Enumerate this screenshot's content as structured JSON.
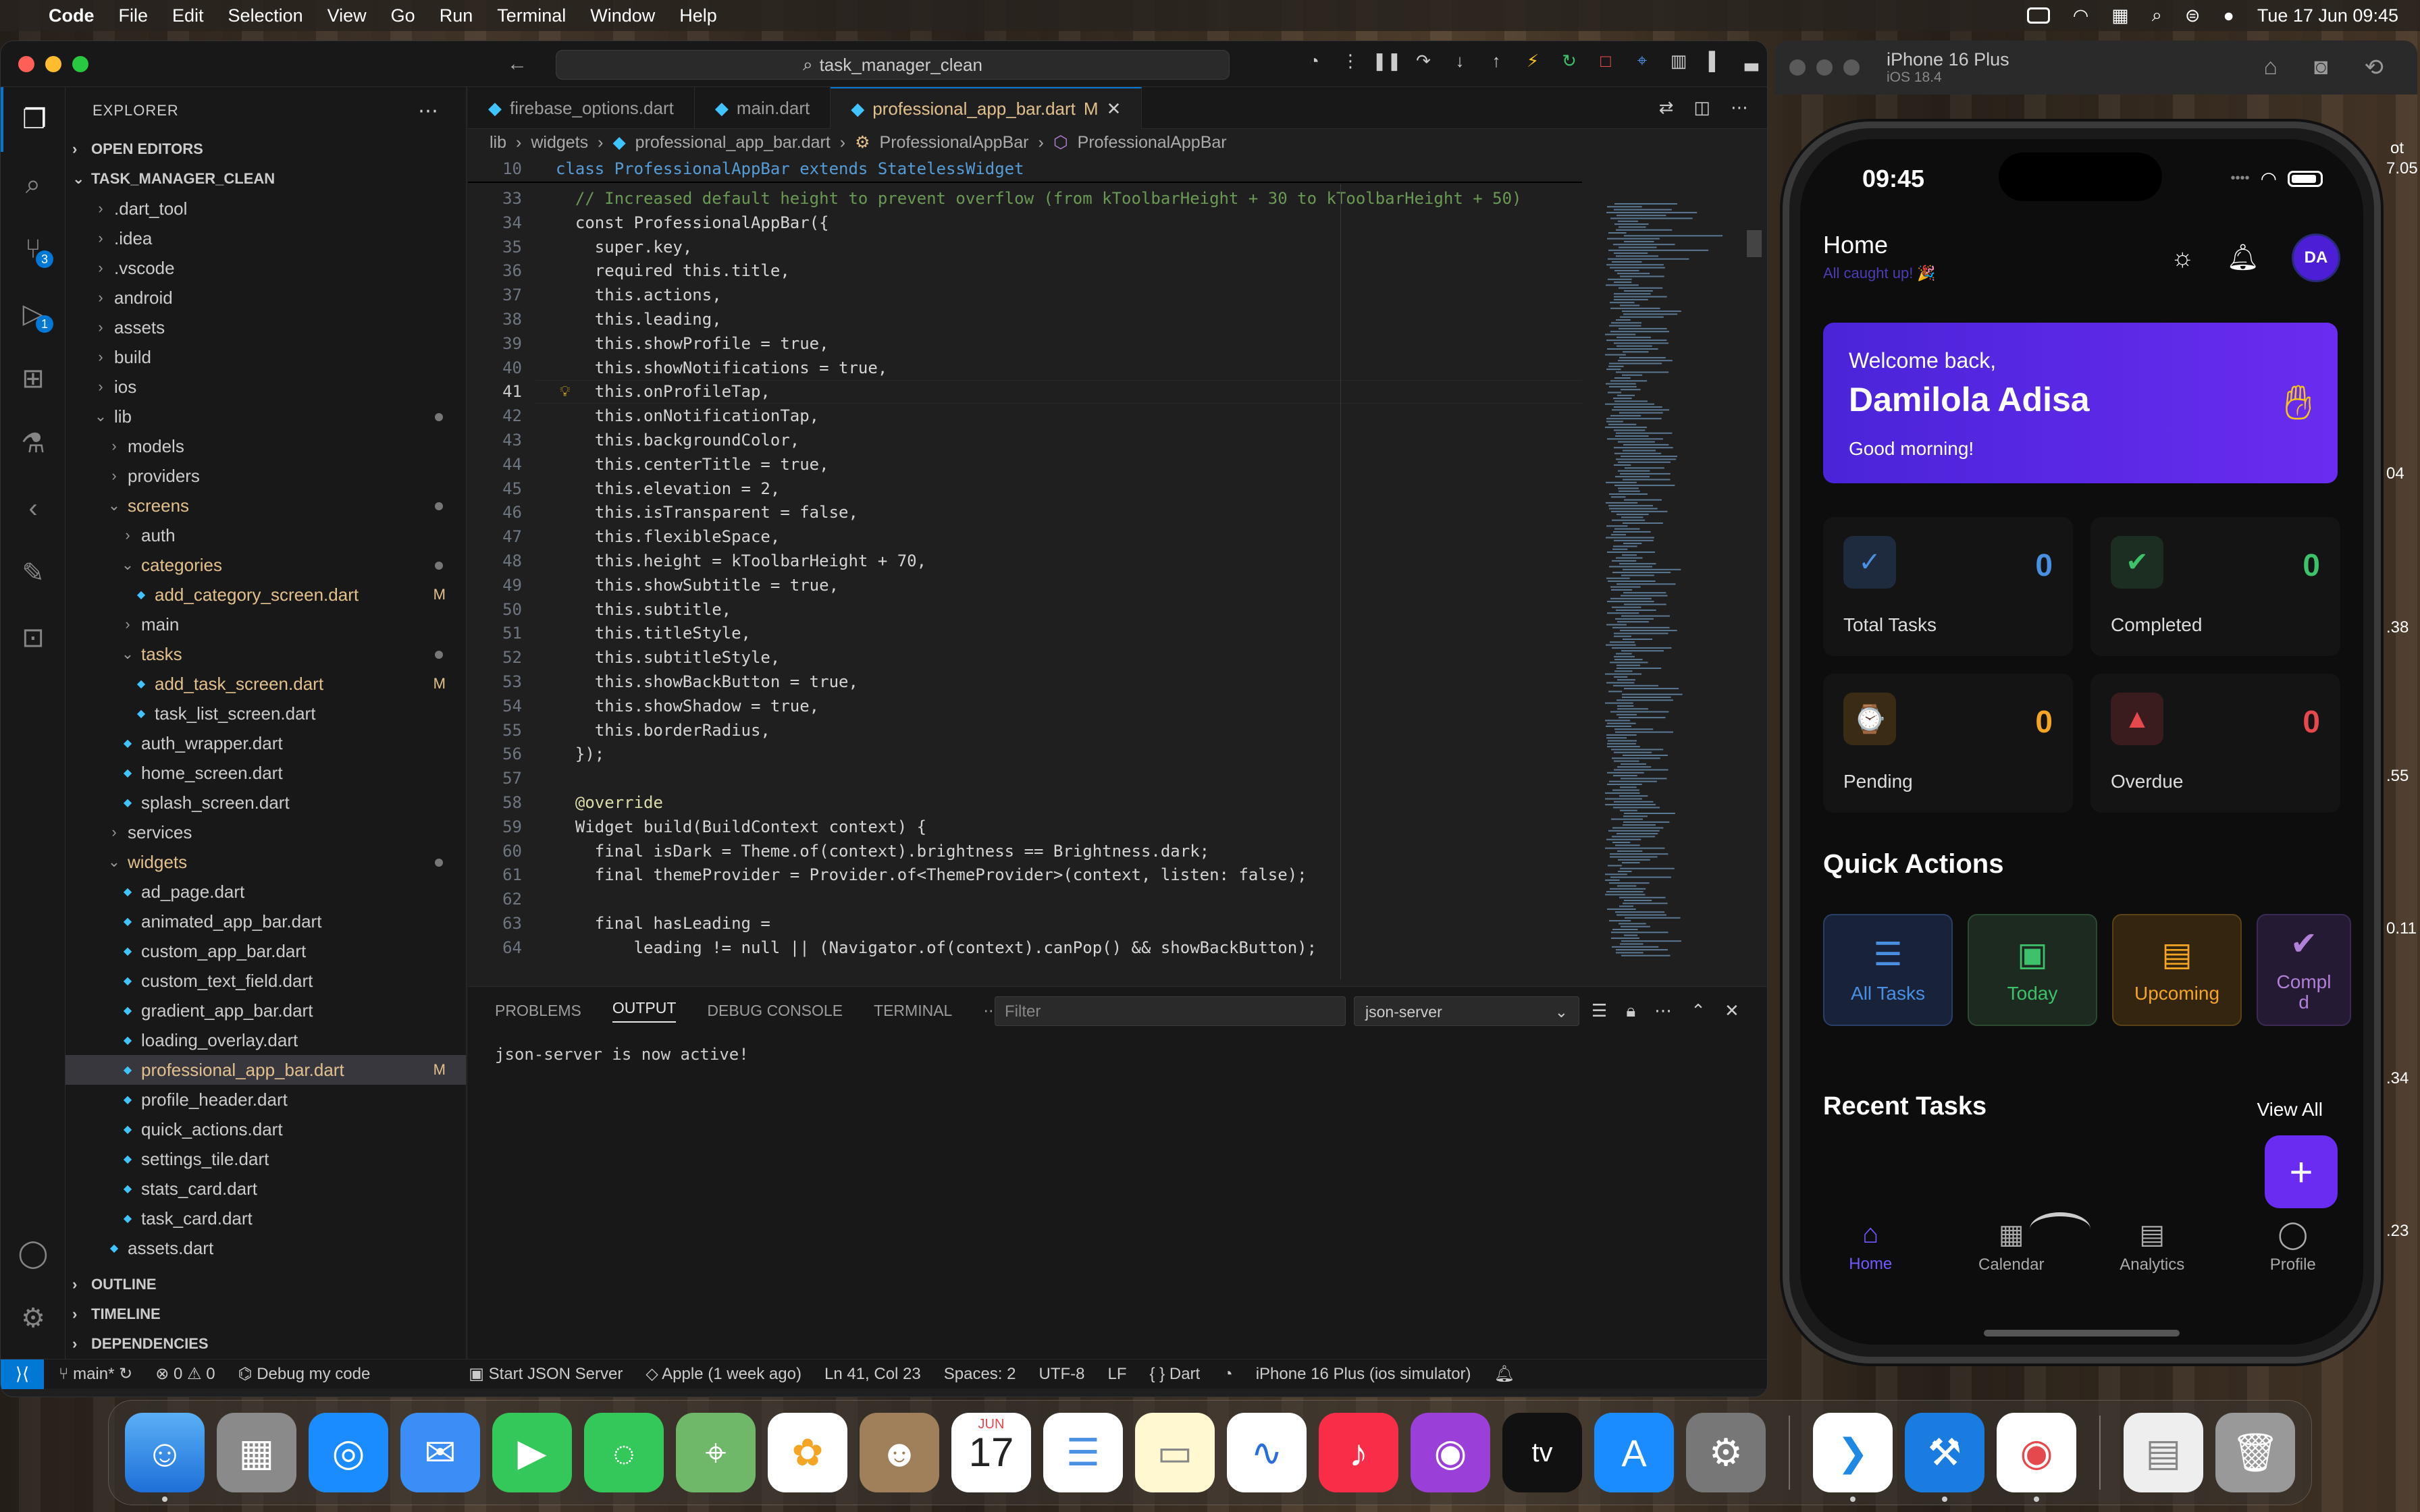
{
  "menubar": {
    "app": "Code",
    "items": [
      "File",
      "Edit",
      "Selection",
      "View",
      "Go",
      "Run",
      "Terminal",
      "Window",
      "Help"
    ],
    "clock": "Tue 17 Jun  09:45"
  },
  "vscode": {
    "search": "task_manager_clean",
    "explorer_title": "EXPLORER",
    "sections": {
      "open_editors": "OPEN EDITORS",
      "project": "TASK_MANAGER_CLEAN",
      "outline": "OUTLINE",
      "timeline": "TIMELINE",
      "dependencies": "DEPENDENCIES"
    },
    "tree": [
      {
        "label": ".dart_tool",
        "indent": 1,
        "type": "folder-closed"
      },
      {
        "label": ".idea",
        "indent": 1,
        "type": "folder-closed"
      },
      {
        "label": ".vscode",
        "indent": 1,
        "type": "folder-closed"
      },
      {
        "label": "android",
        "indent": 1,
        "type": "folder-closed"
      },
      {
        "label": "assets",
        "indent": 1,
        "type": "folder-closed"
      },
      {
        "label": "build",
        "indent": 1,
        "type": "folder-closed"
      },
      {
        "label": "ios",
        "indent": 1,
        "type": "folder-closed"
      },
      {
        "label": "lib",
        "indent": 1,
        "type": "folder-open",
        "dot": true
      },
      {
        "label": "models",
        "indent": 2,
        "type": "folder-closed"
      },
      {
        "label": "providers",
        "indent": 2,
        "type": "folder-closed"
      },
      {
        "label": "screens",
        "indent": 2,
        "type": "folder-open",
        "dot": true
      },
      {
        "label": "auth",
        "indent": 3,
        "type": "folder-closed"
      },
      {
        "label": "categories",
        "indent": 3,
        "type": "folder-open",
        "dot": true
      },
      {
        "label": "add_category_screen.dart",
        "indent": 4,
        "type": "file",
        "mod": "M"
      },
      {
        "label": "main",
        "indent": 3,
        "type": "folder-closed"
      },
      {
        "label": "tasks",
        "indent": 3,
        "type": "folder-open",
        "dot": true
      },
      {
        "label": "add_task_screen.dart",
        "indent": 4,
        "type": "file",
        "mod": "M"
      },
      {
        "label": "task_list_screen.dart",
        "indent": 4,
        "type": "file"
      },
      {
        "label": "auth_wrapper.dart",
        "indent": 3,
        "type": "file"
      },
      {
        "label": "home_screen.dart",
        "indent": 3,
        "type": "file"
      },
      {
        "label": "splash_screen.dart",
        "indent": 3,
        "type": "file"
      },
      {
        "label": "services",
        "indent": 2,
        "type": "folder-closed"
      },
      {
        "label": "widgets",
        "indent": 2,
        "type": "folder-open",
        "dot": true
      },
      {
        "label": "ad_page.dart",
        "indent": 3,
        "type": "file"
      },
      {
        "label": "animated_app_bar.dart",
        "indent": 3,
        "type": "file"
      },
      {
        "label": "custom_app_bar.dart",
        "indent": 3,
        "type": "file"
      },
      {
        "label": "custom_text_field.dart",
        "indent": 3,
        "type": "file"
      },
      {
        "label": "gradient_app_bar.dart",
        "indent": 3,
        "type": "file"
      },
      {
        "label": "loading_overlay.dart",
        "indent": 3,
        "type": "file"
      },
      {
        "label": "professional_app_bar.dart",
        "indent": 3,
        "type": "file",
        "mod": "M",
        "selected": true
      },
      {
        "label": "profile_header.dart",
        "indent": 3,
        "type": "file"
      },
      {
        "label": "quick_actions.dart",
        "indent": 3,
        "type": "file"
      },
      {
        "label": "settings_tile.dart",
        "indent": 3,
        "type": "file"
      },
      {
        "label": "stats_card.dart",
        "indent": 3,
        "type": "file"
      },
      {
        "label": "task_card.dart",
        "indent": 3,
        "type": "file"
      },
      {
        "label": "assets.dart",
        "indent": 2,
        "type": "file"
      }
    ],
    "tabs": [
      {
        "label": "firebase_options.dart",
        "active": false
      },
      {
        "label": "main.dart",
        "active": false
      },
      {
        "label": "professional_app_bar.dart",
        "active": true,
        "mod": "M"
      }
    ],
    "breadcrumb": [
      "lib",
      "widgets",
      "professional_app_bar.dart",
      "ProfessionalAppBar",
      "ProfessionalAppBar"
    ],
    "sticky_line": {
      "num": "10",
      "text": "class ProfessionalAppBar extends StatelessWidget"
    },
    "current_line": "41",
    "code": [
      {
        "n": "33",
        "t": "  // Increased default height to prevent overflow (from kToolbarHeight + 30 to kToolbarHeight + 50)",
        "c": "cm"
      },
      {
        "n": "34",
        "t": "  const ProfessionalAppBar({",
        "c": "pl"
      },
      {
        "n": "35",
        "t": "    super.key,",
        "c": "pl"
      },
      {
        "n": "36",
        "t": "    required this.title,",
        "c": "pl"
      },
      {
        "n": "37",
        "t": "    this.actions,",
        "c": "pl"
      },
      {
        "n": "38",
        "t": "    this.leading,",
        "c": "pl"
      },
      {
        "n": "39",
        "t": "    this.showProfile = true,",
        "c": "pl"
      },
      {
        "n": "40",
        "t": "    this.showNotifications = true,",
        "c": "pl"
      },
      {
        "n": "41",
        "t": "    this.onProfileTap,",
        "c": "pl"
      },
      {
        "n": "42",
        "t": "    this.onNotificationTap,",
        "c": "pl"
      },
      {
        "n": "43",
        "t": "    this.backgroundColor,",
        "c": "pl"
      },
      {
        "n": "44",
        "t": "    this.centerTitle = true,",
        "c": "pl"
      },
      {
        "n": "45",
        "t": "    this.elevation = 2,",
        "c": "pl"
      },
      {
        "n": "46",
        "t": "    this.isTransparent = false,",
        "c": "pl"
      },
      {
        "n": "47",
        "t": "    this.flexibleSpace,",
        "c": "pl"
      },
      {
        "n": "48",
        "t": "    this.height = kToolbarHeight + 70,",
        "c": "pl"
      },
      {
        "n": "49",
        "t": "    this.showSubtitle = true,",
        "c": "pl"
      },
      {
        "n": "50",
        "t": "    this.subtitle,",
        "c": "pl"
      },
      {
        "n": "51",
        "t": "    this.titleStyle,",
        "c": "pl"
      },
      {
        "n": "52",
        "t": "    this.subtitleStyle,",
        "c": "pl"
      },
      {
        "n": "53",
        "t": "    this.showBackButton = true,",
        "c": "pl"
      },
      {
        "n": "54",
        "t": "    this.showShadow = true,",
        "c": "pl"
      },
      {
        "n": "55",
        "t": "    this.borderRadius,",
        "c": "pl"
      },
      {
        "n": "56",
        "t": "  });",
        "c": "pl"
      },
      {
        "n": "57",
        "t": "",
        "c": "pl"
      },
      {
        "n": "58",
        "t": "  @override",
        "c": "an"
      },
      {
        "n": "59",
        "t": "  Widget build(BuildContext context) {",
        "c": "pl"
      },
      {
        "n": "60",
        "t": "    final isDark = Theme.of(context).brightness == Brightness.dark;",
        "c": "pl"
      },
      {
        "n": "61",
        "t": "    final themeProvider = Provider.of<ThemeProvider>(context, listen: false);",
        "c": "pl"
      },
      {
        "n": "62",
        "t": "",
        "c": "pl"
      },
      {
        "n": "63",
        "t": "    final hasLeading =",
        "c": "pl"
      },
      {
        "n": "64",
        "t": "        leading != null || (Navigator.of(context).canPop() && showBackButton);",
        "c": "pl"
      }
    ],
    "panel": {
      "tabs": [
        "PROBLEMS",
        "OUTPUT",
        "DEBUG CONSOLE",
        "TERMINAL"
      ],
      "active_tab": "OUTPUT",
      "filter_placeholder": "Filter",
      "channel": "json-server",
      "output": "json-server is now active!"
    },
    "status": {
      "branch": "main*",
      "problems": "0",
      "warnings": "0",
      "debug": "Debug my code",
      "task": "Start JSON Server",
      "commit": "Apple (1 week ago)",
      "position": "Ln 41, Col 23",
      "spaces": "Spaces: 2",
      "encoding": "UTF-8",
      "eol": "LF",
      "lang": "Dart",
      "device": "iPhone 16 Plus (ios simulator)"
    }
  },
  "simulator": {
    "device": "iPhone 16 Plus",
    "os": "iOS 18.4",
    "phone": {
      "time": "09:45",
      "title": "Home",
      "subtitle": "All caught up! 🎉",
      "avatar": "DA",
      "welcome": "Welcome back,",
      "name": "Damilola Adisa",
      "greeting": "Good morning!",
      "stats": [
        {
          "label": "Total Tasks",
          "value": "0",
          "color": "#4a90e2"
        },
        {
          "label": "Completed",
          "value": "0",
          "color": "#3ec16b"
        },
        {
          "label": "Pending",
          "value": "0",
          "color": "#f5a524"
        },
        {
          "label": "Overdue",
          "value": "0",
          "color": "#e5484d"
        }
      ],
      "quick_actions_title": "Quick Actions",
      "quick_actions": [
        "All Tasks",
        "Today",
        "Upcoming",
        "Compl\nd"
      ],
      "recent_title": "Recent Tasks",
      "view_all": "View All",
      "nav": [
        "Home",
        "Calendar",
        "Analytics",
        "Profile"
      ]
    },
    "side_numbers": [
      "ot",
      "7.05",
      "04",
      ".38",
      ".55",
      "0.11",
      ".34",
      ".23"
    ]
  },
  "dock": {
    "apps": [
      "finder",
      "launchpad",
      "safari",
      "mail",
      "facetime",
      "messages",
      "maps",
      "photos",
      "contacts",
      "calendar",
      "reminders",
      "notes",
      "freeform",
      "music",
      "podcasts",
      "tv",
      "app-store",
      "system-settings",
      "vscode",
      "xcode",
      "chrome",
      "preview",
      "trash"
    ],
    "calendar_month": "JUN",
    "calendar_day": "17",
    "tv_label": "tv"
  }
}
